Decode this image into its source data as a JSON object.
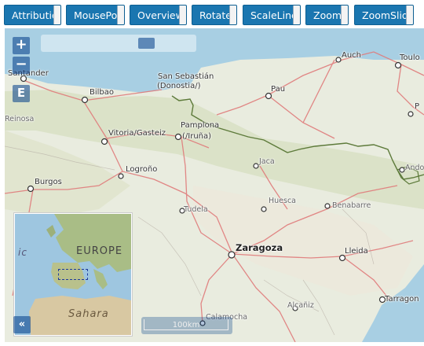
{
  "toolbar": {
    "buttons": [
      "Attribution",
      "MousePos",
      "OverviewM",
      "Rotate",
      "ScaleLine",
      "Zoom",
      "ZoomSlide"
    ]
  },
  "controls": {
    "zoom_in": "+",
    "zoom_out": "−",
    "extent": "E",
    "overview_toggle": "«",
    "zoom_slider_level": 0.7
  },
  "scale": {
    "label": "100km"
  },
  "overview": {
    "europe_label": "EUROPE",
    "partial_label": "ic",
    "sahara_label": "Sahara"
  },
  "places": {
    "santander": "Santander",
    "bilbao": "Bilbao",
    "reinosa": "Reinosa",
    "san_sebastian_1": "San Sebastián",
    "san_sebastian_2": "(Donostia/)",
    "vitoria": "Vitoria/Gasteiz",
    "pamplona_1": "Pamplona",
    "pamplona_2": "(/Iruña)",
    "pau": "Pau",
    "auch": "Auch",
    "toulouse": "Toulo",
    "p_label": "P",
    "logrono": "Logroño",
    "burgos": "Burgos",
    "jaca": "Jaca",
    "andorra": "Ando",
    "tudela": "Tudela",
    "huesca": "Huesca",
    "benabarre": "Benabarre",
    "zaragoza": "Zaragoza",
    "lleida": "Lleida",
    "alcaniz": "Alcañiz",
    "calamocha": "Calamocha",
    "tarragona": "Tarragon"
  },
  "colors": {
    "button_bg": "#1a76b0",
    "control_bg": "#003c88",
    "sea": "#a8cfe3",
    "land": "#e9ecdf",
    "road": "#e07b7b",
    "border": "#5d7a3a"
  }
}
